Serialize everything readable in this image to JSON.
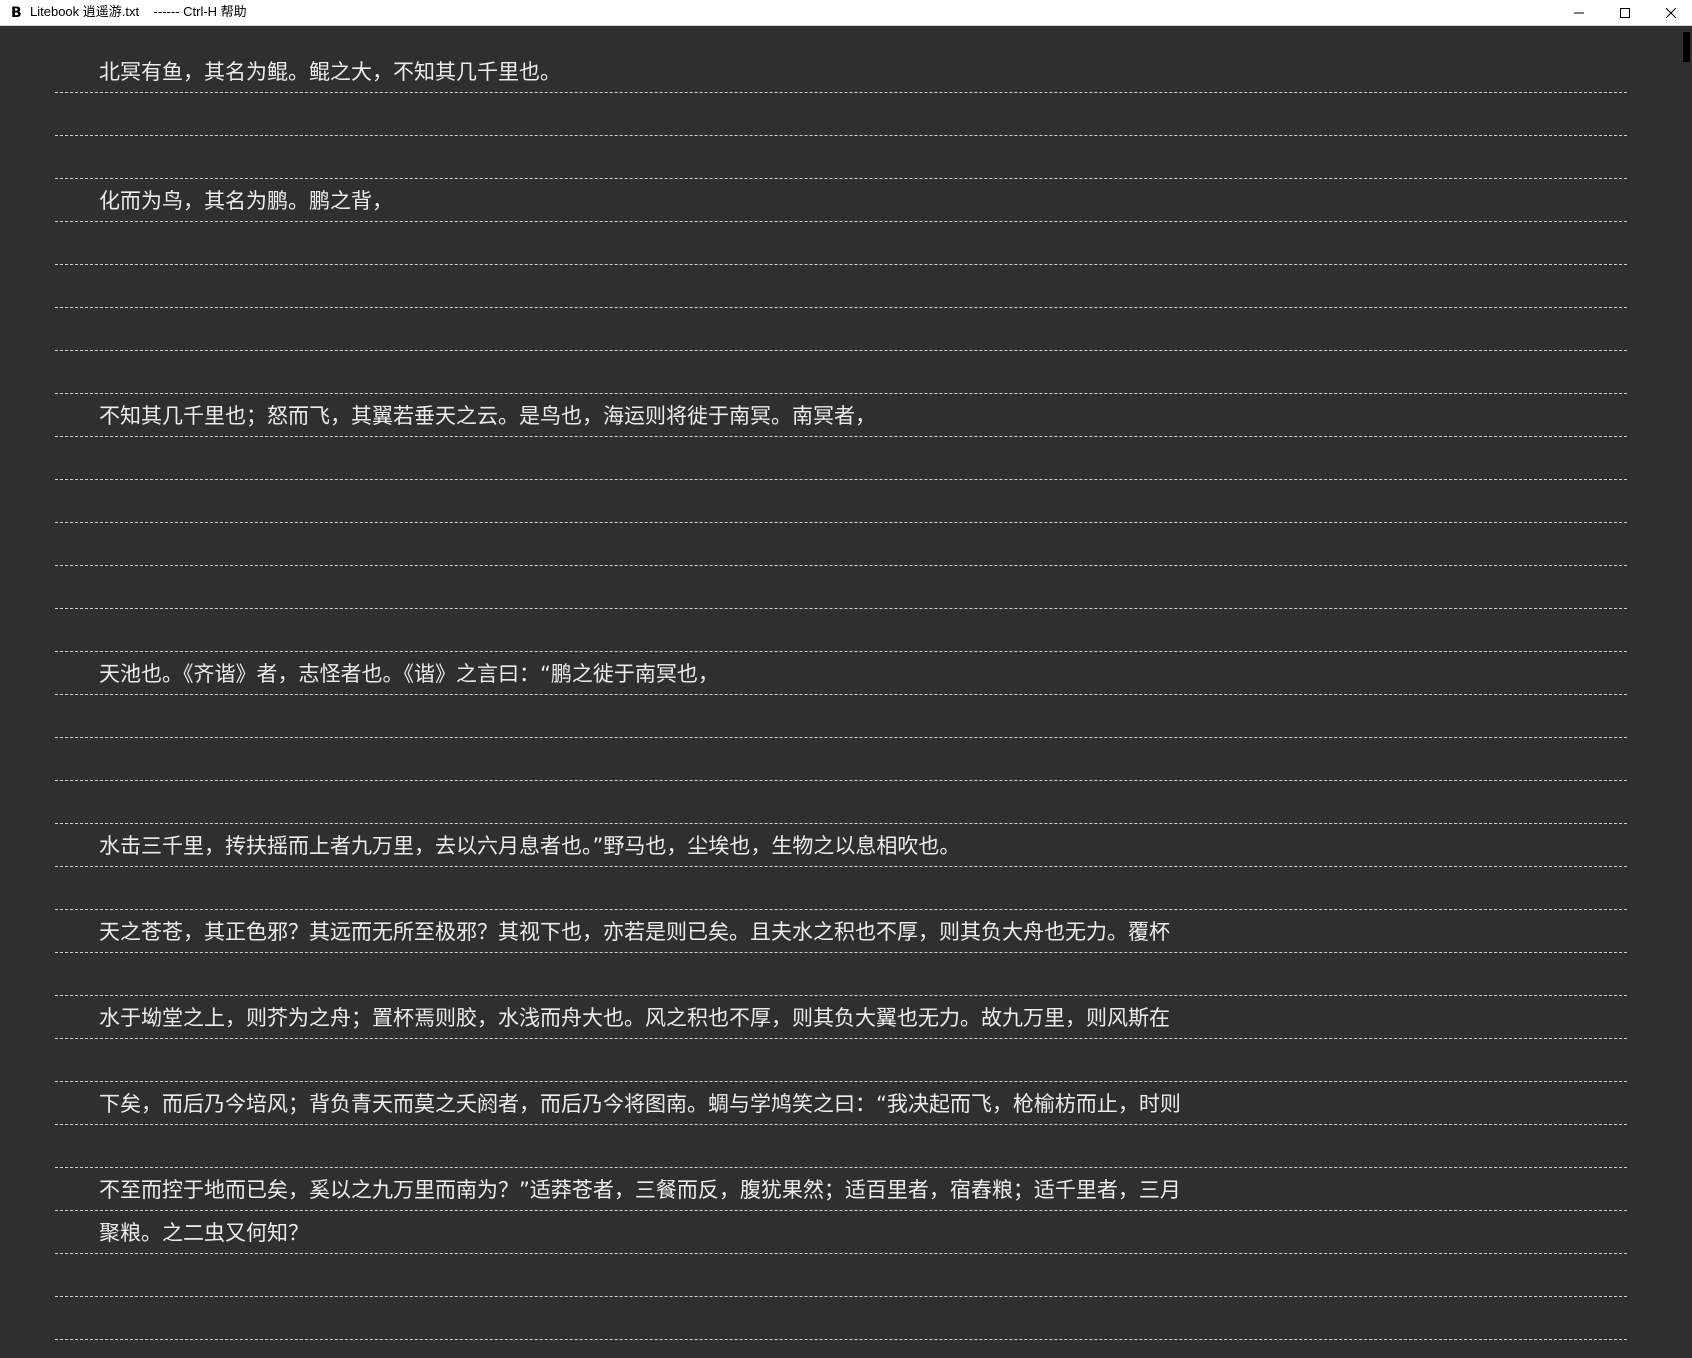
{
  "window": {
    "title": "Litebook 逍遥游.txt    ------ Ctrl-H 帮助",
    "app_icon": "B",
    "controls": {
      "minimize": "minimize-icon",
      "maximize": "maximize-icon",
      "close": "close-icon"
    }
  },
  "reader": {
    "background": "#2f2f2f",
    "text_color": "#ececec",
    "lines": [
      "北冥有鱼，其名为鲲。鲲之大，不知其几千里也。",
      "",
      "",
      "化而为鸟，其名为鹏。鹏之背，",
      "",
      "",
      "",
      "",
      "不知其几千里也；怒而飞，其翼若垂天之云。是鸟也，海运则将徙于南冥。南冥者，",
      "",
      "",
      "",
      "",
      "",
      "天池也。《齐谐》者，志怪者也。《谐》之言曰：“鹏之徙于南冥也，",
      "",
      "",
      "",
      "水击三千里，抟扶摇而上者九万里，去以六月息者也。”野马也，尘埃也，生物之以息相吹也。",
      "",
      "天之苍苍，其正色邪？其远而无所至极邪？其视下也，亦若是则已矣。且夫水之积也不厚，则其负大舟也无力。覆杯",
      "",
      "水于坳堂之上，则芥为之舟；置杯焉则胶，水浅而舟大也。风之积也不厚，则其负大翼也无力。故九万里，则风斯在",
      "",
      "下矣，而后乃今培风；背负青天而莫之夭阏者，而后乃今将图南。蜩与学鸠笑之曰：“我决起而飞，枪榆枋而止，时则",
      "",
      "不至而控于地而已矣，奚以之九万里而南为？”适莽苍者，三餐而反，腹犹果然；适百里者，宿舂粮；适千里者，三月",
      "聚粮。之二虫又何知？",
      "",
      ""
    ]
  }
}
